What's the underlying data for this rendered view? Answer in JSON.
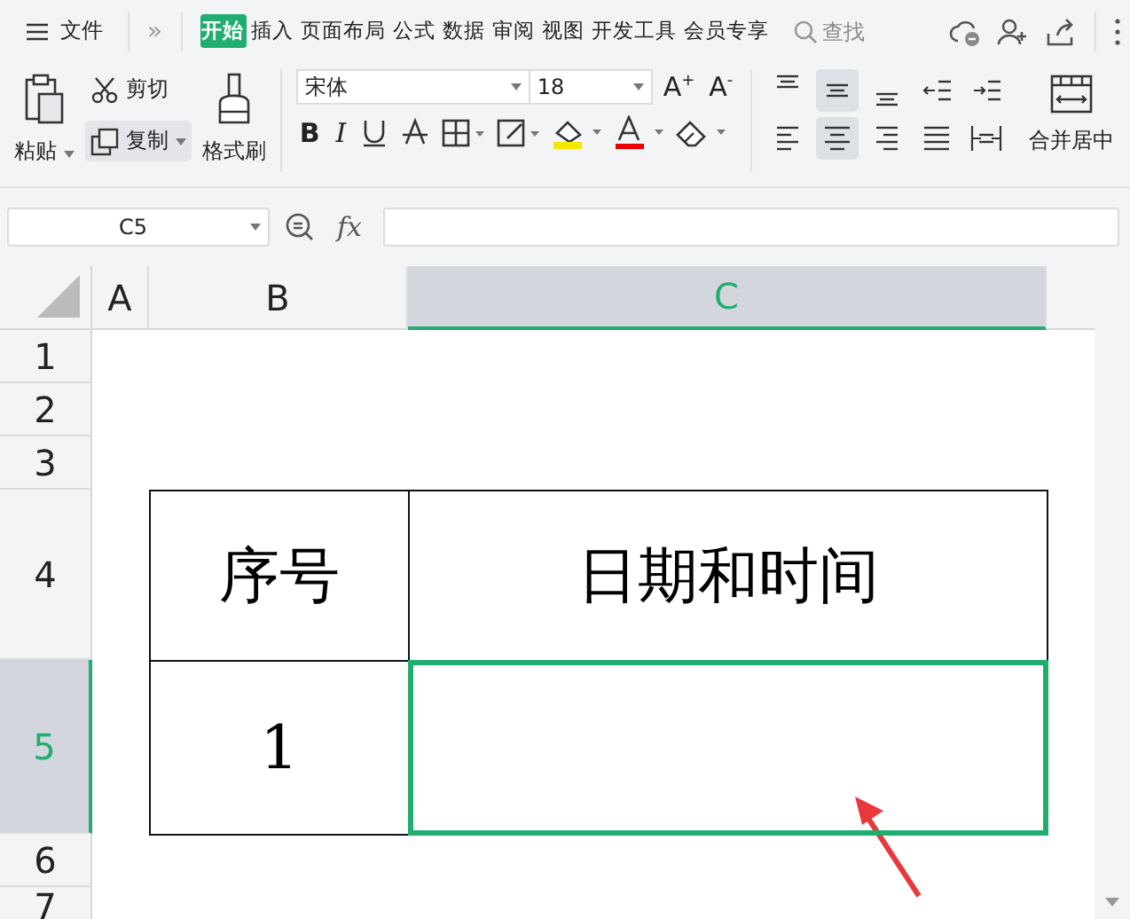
{
  "menu": {
    "file": "文件",
    "more": "»",
    "tabs": [
      {
        "label": "开始",
        "selected": true
      },
      {
        "label": "插入",
        "selected": false
      },
      {
        "label": "页面布局",
        "selected": false
      },
      {
        "label": "公式",
        "selected": false
      },
      {
        "label": "数据",
        "selected": false
      },
      {
        "label": "审阅",
        "selected": false
      },
      {
        "label": "视图",
        "selected": false
      },
      {
        "label": "开发工具",
        "selected": false
      },
      {
        "label": "会员专享",
        "selected": false
      }
    ],
    "search": {
      "placeholder": "查找"
    }
  },
  "toolbar": {
    "paste": "粘贴",
    "cut": "剪切",
    "copy": "复制",
    "format_painter": "格式刷",
    "font": "宋体",
    "font_size": "18",
    "grow": "A$^{+}$",
    "shrink": "A$^{-}$",
    "bold": "B",
    "italic": "I",
    "merge": "合并居中",
    "alignment": [
      {
        "kind": "top",
        "selected": false
      },
      {
        "kind": "middle",
        "selected": true
      },
      {
        "kind": "bottom",
        "selected": false
      },
      {
        "kind": "outdent",
        "selected": false
      },
      {
        "kind": "indent",
        "selected": false
      },
      {
        "kind": "left",
        "selected": false
      },
      {
        "kind": "center",
        "selected": true
      },
      {
        "kind": "right",
        "selected": false
      },
      {
        "kind": "justify",
        "selected": false
      },
      {
        "kind": "distributed",
        "selected": false
      }
    ]
  },
  "formula_bar": {
    "name_box": "C5",
    "fx": "fx"
  },
  "sheet": {
    "columns": [
      {
        "label": "A",
        "selected": false
      },
      {
        "label": "B",
        "selected": false
      },
      {
        "label": "C",
        "selected": true
      }
    ],
    "rows": [
      {
        "label": "1",
        "selected": false
      },
      {
        "label": "2",
        "selected": false
      },
      {
        "label": "3",
        "selected": false
      },
      {
        "label": "4",
        "selected": false
      },
      {
        "label": "5",
        "selected": true
      },
      {
        "label": "6",
        "selected": false
      },
      {
        "label": "7",
        "selected": false
      }
    ],
    "table": [
      {
        "cells": [
          {
            "text": "序号",
            "selected": false
          },
          {
            "text": "日期和时间",
            "selected": false
          }
        ]
      },
      {
        "cells": [
          {
            "text": "1",
            "selected": false
          },
          {
            "selected": true
          }
        ]
      }
    ]
  }
}
